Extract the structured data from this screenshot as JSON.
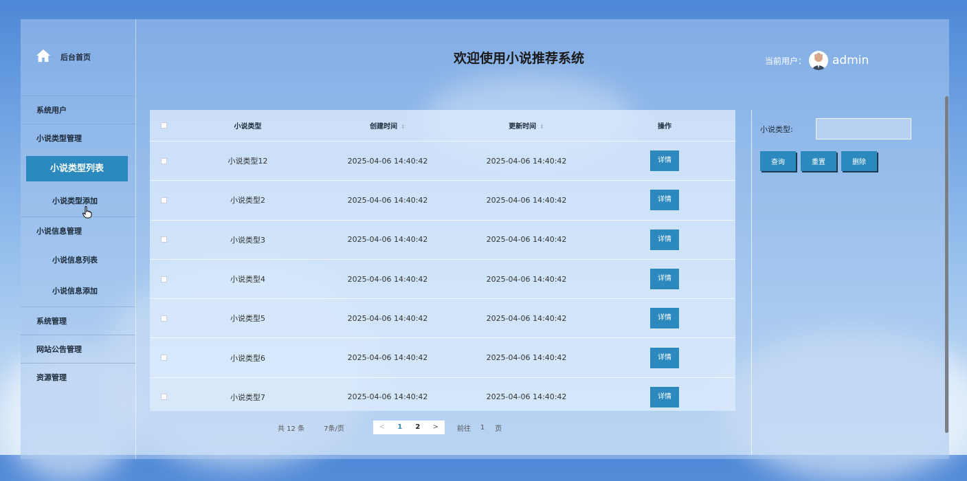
{
  "header": {
    "title": "欢迎使用小说推荐系统",
    "user_label": "当前用户：",
    "username": "admin"
  },
  "sidebar": {
    "home_label": "后台首页",
    "items": [
      {
        "label": "系统用户",
        "level": 1
      },
      {
        "label": "小说类型管理",
        "level": 1
      },
      {
        "label": "小说类型列表",
        "level": 2,
        "active": true
      },
      {
        "label": "小说类型添加",
        "level": 2
      },
      {
        "label": "小说信息管理",
        "level": 1
      },
      {
        "label": "小说信息列表",
        "level": 2
      },
      {
        "label": "小说信息添加",
        "level": 2
      },
      {
        "label": "系统管理",
        "level": 1
      },
      {
        "label": "网站公告管理",
        "level": 1
      },
      {
        "label": "资源管理",
        "level": 1
      }
    ]
  },
  "table": {
    "columns": [
      "小说类型",
      "创建时间",
      "更新时间",
      "操作"
    ],
    "rows": [
      {
        "type": "小说类型12",
        "created": "2025-04-06 14:40:42",
        "updated": "2025-04-06 14:40:42",
        "action": "详情"
      },
      {
        "type": "小说类型2",
        "created": "2025-04-06 14:40:42",
        "updated": "2025-04-06 14:40:42",
        "action": "详情"
      },
      {
        "type": "小说类型3",
        "created": "2025-04-06 14:40:42",
        "updated": "2025-04-06 14:40:42",
        "action": "详情"
      },
      {
        "type": "小说类型4",
        "created": "2025-04-06 14:40:42",
        "updated": "2025-04-06 14:40:42",
        "action": "详情"
      },
      {
        "type": "小说类型5",
        "created": "2025-04-06 14:40:42",
        "updated": "2025-04-06 14:40:42",
        "action": "详情"
      },
      {
        "type": "小说类型6",
        "created": "2025-04-06 14:40:42",
        "updated": "2025-04-06 14:40:42",
        "action": "详情"
      },
      {
        "type": "小说类型7",
        "created": "2025-04-06 14:40:42",
        "updated": "2025-04-06 14:40:42",
        "action": "详情"
      }
    ]
  },
  "pagination": {
    "total": "共 12 条",
    "per_page": "7条/页",
    "prev": "<",
    "pages": [
      "1",
      "2"
    ],
    "current": "1",
    "next": ">",
    "goto_label": "前往",
    "goto_value": "1",
    "page_unit": "页"
  },
  "filter": {
    "label": "小说类型:",
    "value": "",
    "query": "查询",
    "reset": "重置",
    "delete": "删除"
  },
  "colors": {
    "accent": "#2b89bd"
  }
}
